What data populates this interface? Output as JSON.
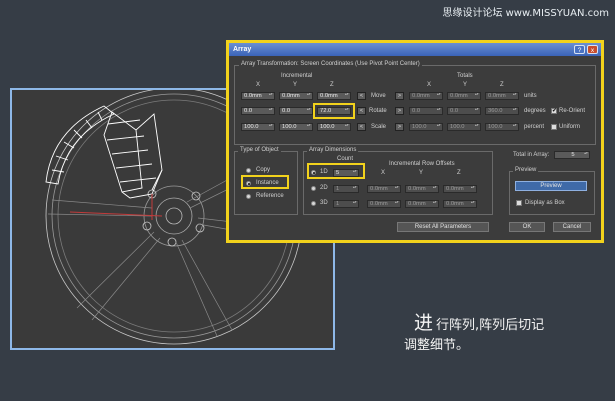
{
  "watermark": "思缘设计论坛 www.MISSYUAN.com",
  "dialog": {
    "title": "Array",
    "help_glyph": "?",
    "close_glyph": "x",
    "transform_group": "Array Transformation: Screen Coordinates (Use Pivot Point Center)",
    "incremental": "Incremental",
    "totals": "Totals",
    "axes": [
      "X",
      "Y",
      "Z"
    ],
    "rows": [
      {
        "label": "Move",
        "inc": [
          "0.0mm",
          "0.0mm",
          "0.0mm"
        ],
        "tot": [
          "0.0mm",
          "0.0mm",
          "0.0mm"
        ],
        "unit": "units"
      },
      {
        "label": "Rotate",
        "inc": [
          "0.0",
          "0.0",
          "72.0"
        ],
        "tot": [
          "0.0",
          "0.0",
          "360.0"
        ],
        "unit": "degrees"
      },
      {
        "label": "Scale",
        "inc": [
          "100.0",
          "100.0",
          "100.0"
        ],
        "tot": [
          "100.0",
          "100.0",
          "100.0"
        ],
        "unit": "percent"
      }
    ],
    "arrow_left": "<",
    "arrow_right": ">",
    "re_orient": "Re-Orient",
    "uniform": "Uniform",
    "type_group": "Type of Object",
    "copy": "Copy",
    "instance": "Instance",
    "reference": "Reference",
    "dims_group": "Array Dimensions",
    "count": "Count",
    "row_offsets": "Incremental Row Offsets",
    "dim_1d": "1D",
    "dim_2d": "2D",
    "dim_3d": "3D",
    "count_1d": "5",
    "count_2d": "1",
    "count_3d": "1",
    "off2": [
      "0.0mm",
      "0.0mm",
      "0.0mm"
    ],
    "off3": [
      "0.0mm",
      "0.0mm",
      "0.0mm"
    ],
    "total_in_array_label": "Total in Array:",
    "total_in_array": "5",
    "preview_group": "Preview",
    "preview_btn": "Preview",
    "display_as_box": "Display as Box",
    "reset_btn": "Reset All Parameters",
    "ok_btn": "OK",
    "cancel_btn": "Cancel",
    "check_glyph": "✔"
  },
  "caption": {
    "big": "进",
    "line1": "行阵列,阵列后切记",
    "line2": "调整细节。"
  },
  "colors": {
    "highlight": "#f2d21c",
    "viewport_border": "#8eb8e8",
    "title_bar": "#3a63b8"
  }
}
